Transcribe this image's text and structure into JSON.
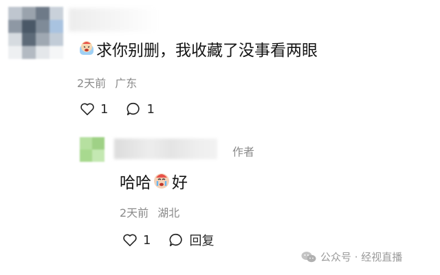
{
  "comment": {
    "text_prefix_emoji": "crying-face-emoji",
    "text": "求你别删，我收藏了没事看两眼",
    "time": "2天前",
    "location": "广东",
    "like_count": "1",
    "reply_count": "1"
  },
  "reply": {
    "text_before": "哈哈",
    "emoji": "crying-face-emoji",
    "text_after": "好",
    "author_tag": "作者",
    "time": "2天前",
    "location": "湖北",
    "like_count": "1",
    "reply_label": "回复"
  },
  "watermark": {
    "text": "公众号 · 经视直播"
  },
  "colors": {
    "text_primary": "#141414",
    "text_meta": "#8a8a8a",
    "avatar_reply": "#a8d98f"
  }
}
